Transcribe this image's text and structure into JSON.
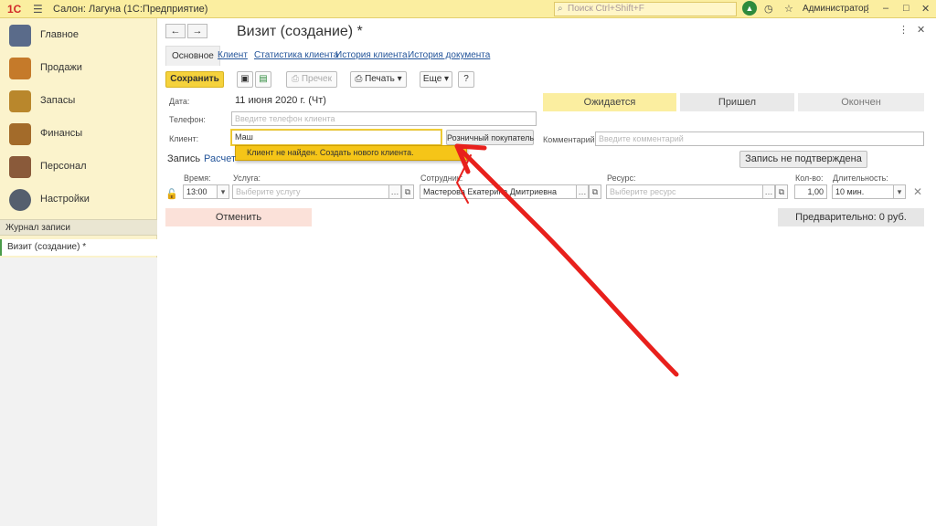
{
  "titlebar": {
    "logo": "1С",
    "app_title": "Салон: Лагуна  (1С:Предприятие)",
    "search_placeholder": "Поиск Ctrl+Shift+F",
    "user": "Администратор"
  },
  "sidebar": {
    "items": [
      {
        "label": "Главное",
        "color": "#5a6b8a"
      },
      {
        "label": "Продажи",
        "color": "#c57a2a"
      },
      {
        "label": "Запасы",
        "color": "#b9872c"
      },
      {
        "label": "Финансы",
        "color": "#a36b2a"
      },
      {
        "label": "Персонал",
        "color": "#8a5a3a"
      },
      {
        "label": "Настройки",
        "color": "#555f6e"
      }
    ],
    "journal_header": "Журнал записи",
    "journal_item": "Визит (создание) *"
  },
  "document": {
    "title": "Визит (создание) *",
    "tabs": [
      "Основное",
      "Клиент",
      "Статистика клиента",
      "История клиента",
      "История документа"
    ],
    "toolbar": {
      "save": "Сохранить",
      "post": "Провести и закрыть",
      "print_btn": "Печать",
      "prechek": "Пречек",
      "more": "Еще",
      "help": "?"
    },
    "date_label": "Дата:",
    "date_value": "11 июня 2020 г. (Чт)",
    "phone_label": "Телефон:",
    "phone_placeholder": "Введите телефон клиента",
    "client_label": "Клиент:",
    "client_value": "Маш",
    "retail_button": "Розничный покупатель",
    "dropdown_text": "Клиент не найден. Создать нового клиента.",
    "status_buttons": [
      "Ожидается",
      "Пришел",
      "Окончен"
    ],
    "comment_label": "Комментарий:",
    "comment_placeholder": "Введите комментарий",
    "subtabs": [
      "Запись",
      "Расчет"
    ],
    "unconfirmed_button": "Запись не подтверждена",
    "row": {
      "time_label": "Время:",
      "time_value": "13:00",
      "service_label": "Услуга:",
      "service_placeholder": "Выберите услугу",
      "employee_label": "Сотрудник:",
      "employee_value": "Мастерова Екатерина Дмитриевна",
      "resource_label": "Ресурс:",
      "resource_placeholder": "Выберите ресурс",
      "qty_label": "Кол-во:",
      "qty_value": "1,00",
      "duration_label": "Длительность:",
      "duration_value": "10 мин."
    },
    "cancel_button": "Отменить",
    "prelim_text": "Предварительно: 0 руб."
  }
}
